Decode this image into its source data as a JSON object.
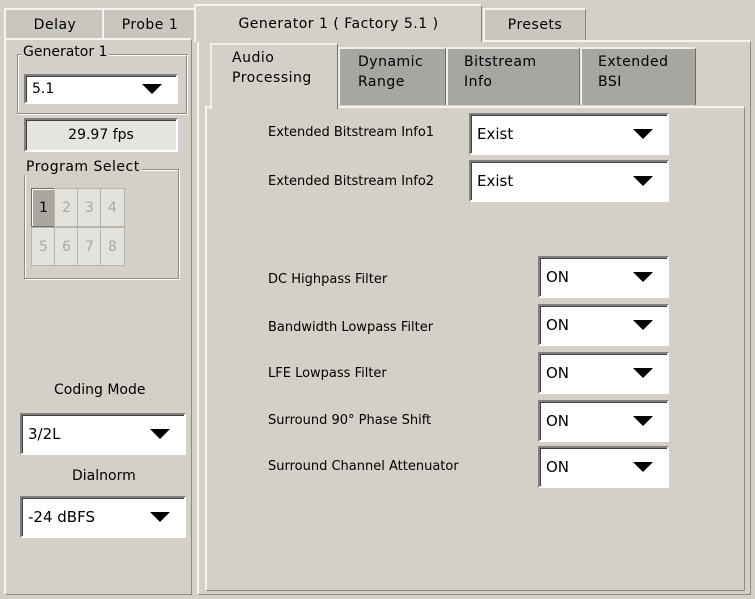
{
  "top_tabs": [
    "Delay",
    "Probe 1",
    "Generator 1 ( Factory 5.1 )",
    "Presets"
  ],
  "left": {
    "generator_legend": "Generator 1",
    "generator_value": "5.1",
    "fps": "29.97 fps",
    "program_legend": "Program Select",
    "program_buttons": [
      "1",
      "2",
      "3",
      "4",
      "5",
      "6",
      "7",
      "8"
    ],
    "program_selected": "1",
    "coding_mode_label": "Coding Mode",
    "coding_mode_value": "3/2L",
    "dialnorm_label": "Dialnorm",
    "dialnorm_value": "-24 dBFS"
  },
  "sub_tabs": [
    {
      "line1": "Audio",
      "line2": "Processing"
    },
    {
      "line1": "Dynamic",
      "line2": "Range"
    },
    {
      "line1": "Bitstream",
      "line2": "Info"
    },
    {
      "line1": "Extended",
      "line2": "BSI"
    }
  ],
  "fields": {
    "ebi1": {
      "label": "Extended Bitstream Info1",
      "value": "Exist"
    },
    "ebi2": {
      "label": "Extended Bitstream Info2",
      "value": "Exist"
    },
    "dc_highpass": {
      "label": "DC Highpass Filter",
      "value": "ON"
    },
    "bw_lowpass": {
      "label": "Bandwidth Lowpass Filter",
      "value": "ON"
    },
    "lfe_lowpass": {
      "label": "LFE Lowpass Filter",
      "value": "ON"
    },
    "surround_phase": {
      "label": "Surround 90° Phase Shift",
      "value": "ON"
    },
    "surround_atten": {
      "label": "Surround Channel Attenuator",
      "value": "ON"
    }
  }
}
